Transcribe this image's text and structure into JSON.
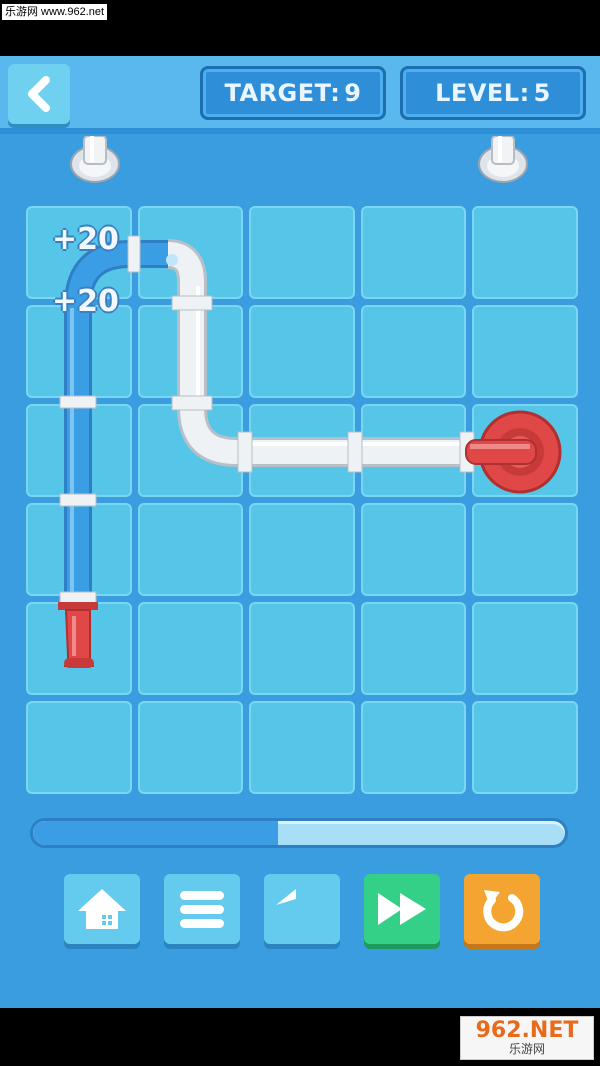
{
  "watermark": {
    "top_text": "乐游网 www.962.net",
    "logo_big": "962.NET",
    "logo_small": "乐游网"
  },
  "header": {
    "back_icon": "chevron-left-icon",
    "target_label": "TARGET:",
    "target_value": "9",
    "level_label": "LEVEL:",
    "level_value": "5"
  },
  "board": {
    "columns": 5,
    "rows": 6,
    "score_popups": [
      "+20",
      "+20"
    ]
  },
  "progress": {
    "fill_fraction": 0.46
  },
  "controls": [
    {
      "name": "home",
      "icon": "home-icon"
    },
    {
      "name": "menu",
      "icon": "menu-icon"
    },
    {
      "name": "undo",
      "icon": "undo-icon"
    },
    {
      "name": "fast-forward",
      "icon": "fast-forward-icon"
    },
    {
      "name": "restart",
      "icon": "restart-icon"
    }
  ],
  "colors": {
    "background": "#3a9de0",
    "cell": "#56c6e8",
    "water": "#3b9ee4",
    "pipe": "#eef2f5",
    "valve": "#e04848",
    "fast_forward": "#34d087",
    "restart": "#f4a531"
  }
}
